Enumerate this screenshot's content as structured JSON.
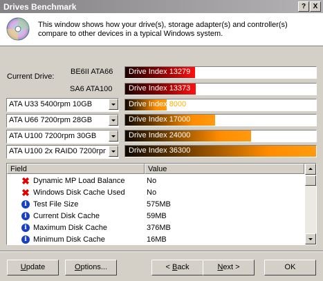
{
  "window": {
    "title": "Drives Benchmark",
    "help_label": "?",
    "close_label": "X"
  },
  "header": {
    "description": "This window shows how your drive(s), storage adapter(s) and controller(s) compare to other devices in a typical Windows system."
  },
  "current_drive_label": "Current Drive:",
  "current_drives": [
    {
      "name": "BE6II ATA66",
      "index_text": "Drive Index 13279",
      "index": 13279,
      "fill": 0.37,
      "color": "red"
    },
    {
      "name": "SA6 ATA100",
      "index_text": "Drive Index 13373",
      "index": 13373,
      "fill": 0.37,
      "color": "red"
    }
  ],
  "reference_drives": [
    {
      "combo_value": "ATA U33 5400rpm 10GB",
      "index_label": "Drive Index",
      "index_value": "8000",
      "index": 8000,
      "fill": 0.22
    },
    {
      "combo_value": "ATA U66 7200rpm 28GB",
      "index_text": "Drive Index 17000",
      "index": 17000,
      "fill": 0.47
    },
    {
      "combo_value": "ATA U100 7200rpm 30GB",
      "index_text": "Drive Index 24000",
      "index": 24000,
      "fill": 0.66
    },
    {
      "combo_value": "ATA U100 2x RAID0 7200rpm",
      "index_text": "Drive Index 36300",
      "index": 36300,
      "fill": 1.0
    }
  ],
  "list": {
    "columns": {
      "field": "Field",
      "value": "Value"
    },
    "rows": [
      {
        "icon": "x-icon",
        "field": "Dynamic MP Load Balance",
        "value": "No"
      },
      {
        "icon": "x-icon",
        "field": "Windows Disk Cache Used",
        "value": "No"
      },
      {
        "icon": "info-icon",
        "field": "Test File Size",
        "value": "575MB"
      },
      {
        "icon": "info-icon",
        "field": "Current Disk Cache",
        "value": "59MB"
      },
      {
        "icon": "info-icon",
        "field": "Maximum Disk Cache",
        "value": "376MB"
      },
      {
        "icon": "info-icon",
        "field": "Minimum Disk Cache",
        "value": "16MB"
      }
    ]
  },
  "buttons": {
    "update": {
      "first": "U",
      "rest": "pdate"
    },
    "options": {
      "first": "O",
      "rest": "ptions..."
    },
    "back": {
      "prefix": "< ",
      "first": "B",
      "rest": "ack"
    },
    "next": {
      "first": "N",
      "rest": "ext >"
    },
    "ok": "OK"
  },
  "colors": {
    "red_bar": "#ff1010",
    "orange_bar": "#ff8c00",
    "orange_text": "#ffb000",
    "face": "#d4d0c8"
  }
}
